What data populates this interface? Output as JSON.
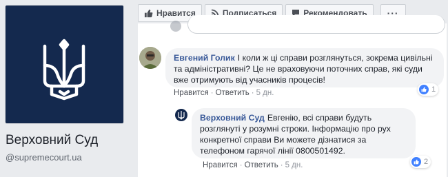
{
  "page": {
    "name": "Верховний Суд",
    "handle": "@supremecourt.ua"
  },
  "action_bar": {
    "like_label": "Нравится",
    "subscribe_label": "Подписаться",
    "recommend_label": "Рекомендовать",
    "more_label": "···"
  },
  "comments": [
    {
      "author": "Евгений Голик",
      "text": "І коли ж ці справи розглянуться, зокрема цивільні та адміністративні? Це не враховуючи поточних справ, які суди вже отримують від учасників процесів!",
      "like_label": "Нравится",
      "reply_label": "Ответить",
      "time": "5 дн.",
      "reactions": "1"
    },
    {
      "author": "Верховний Суд",
      "text": "Евгенію, всі справи будуть розглянуті у розумні строки. Інформацію про рух конкретної справи Ви можете дізнатися за телефоном гарячої лінії 0800501492.",
      "like_label": "Нравится",
      "reply_label": "Ответить",
      "time": "5 дн.",
      "reactions": "2"
    }
  ],
  "colors": {
    "brand_blue": "#14294e",
    "link": "#385898",
    "like": "#4080ff"
  }
}
